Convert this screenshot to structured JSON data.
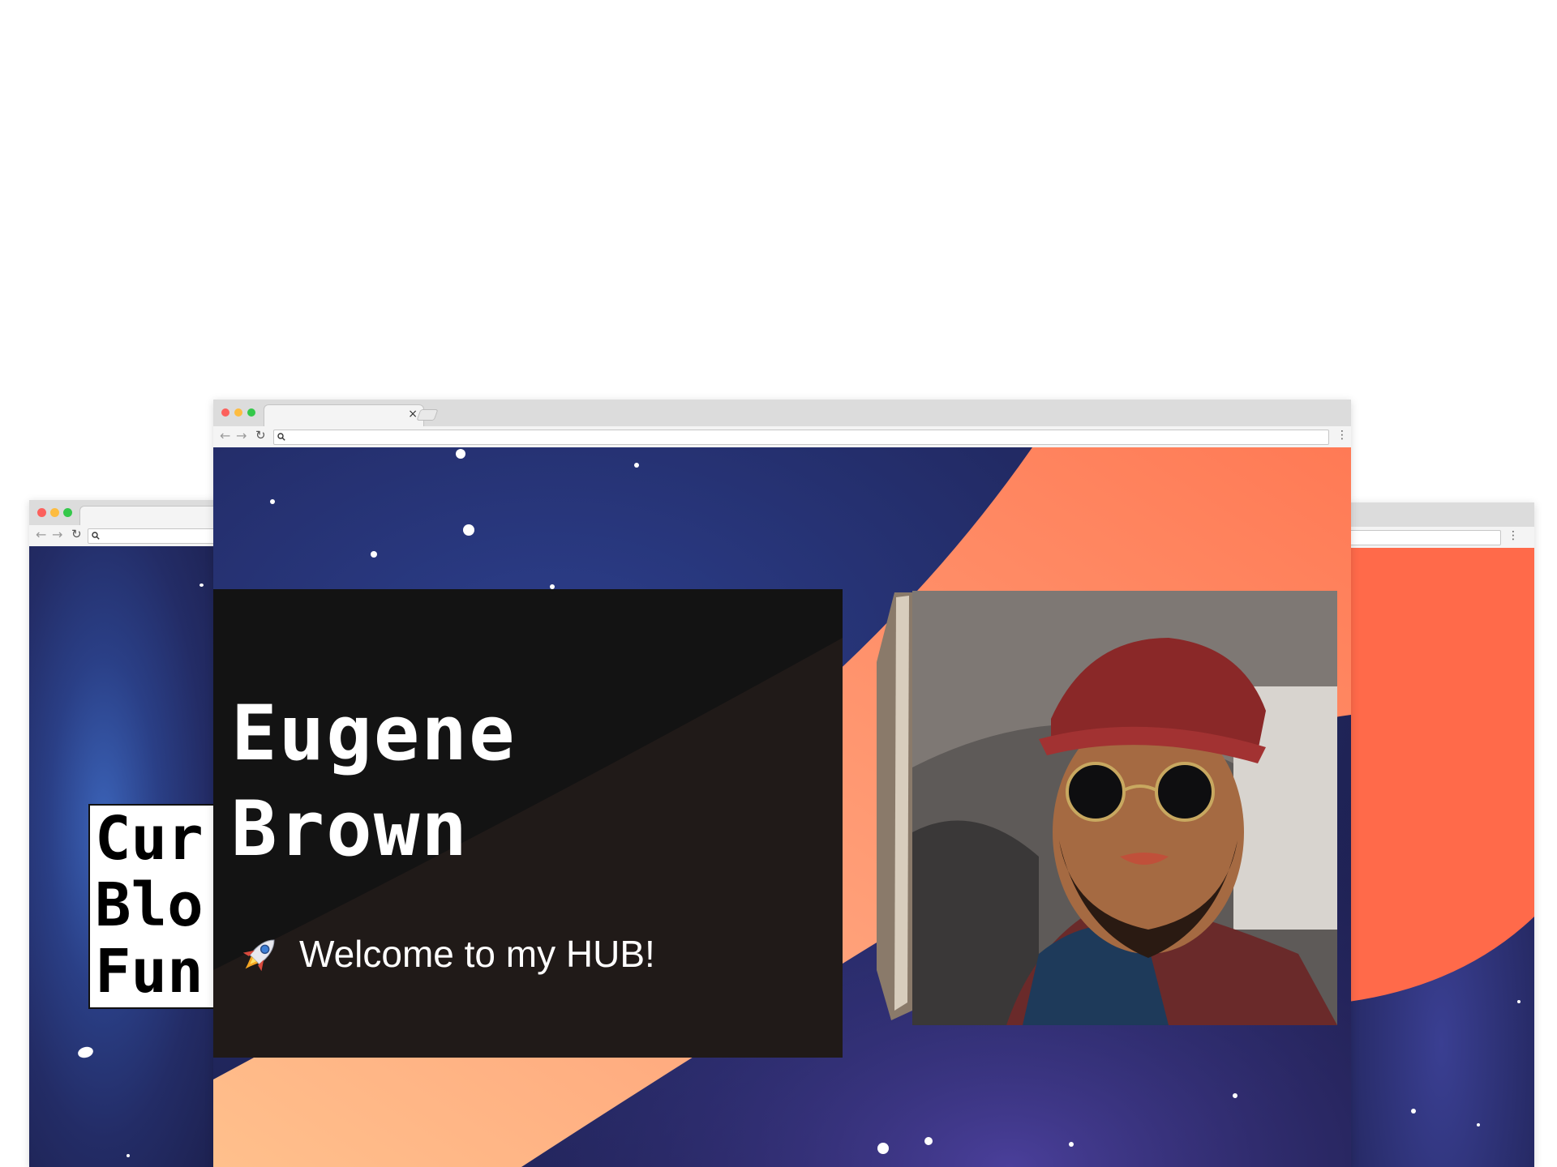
{
  "colors": {
    "space_dark": "#1d2150",
    "space_blue": "#3b63b8",
    "accent_coral": "#ff8a60",
    "accent_peach": "#ffc090",
    "card_black": "#131313",
    "text_white": "#ffffff",
    "close_dot": "#fc605c",
    "minimize_dot": "#fdbc40",
    "zoom_dot": "#34c84a"
  },
  "main_window": {
    "tab_close": "×",
    "omnibox": {
      "value": "",
      "placeholder": ""
    },
    "hero": {
      "name_line1": "Eugene",
      "name_line2": "Brown",
      "welcome_text": "Welcome to my HUB!",
      "welcome_icon": "rocket-icon",
      "photo": "portrait-photo"
    }
  },
  "left_window": {
    "omnibox": {
      "value": "",
      "placeholder": ""
    },
    "card_title": "Cur\nBlo\nFun"
  },
  "right_window": {
    "omnibox": {
      "value": "",
      "placeholder": ""
    }
  },
  "icons": {
    "back": "back-arrow-icon",
    "forward": "forward-arrow-icon",
    "reload": "reload-icon",
    "search": "search-icon",
    "menu": "kebab-menu-icon"
  }
}
